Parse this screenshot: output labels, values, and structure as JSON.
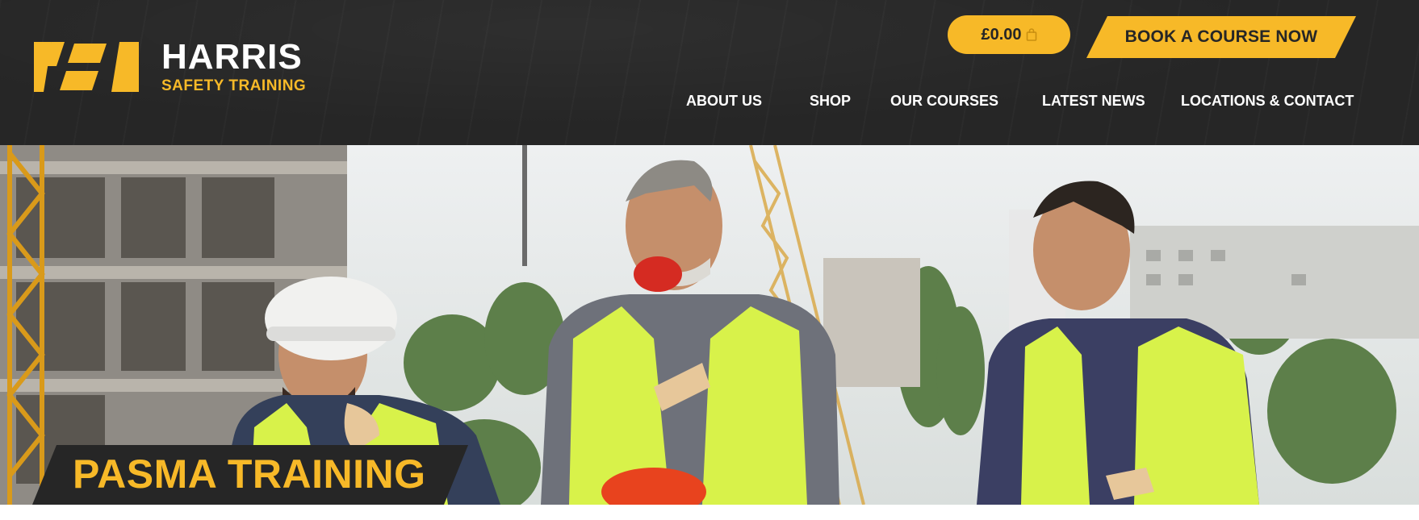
{
  "brand": {
    "name": "HARRIS",
    "tagline": "SAFETY TRAINING",
    "accent": "#f7b928",
    "dark": "#262626"
  },
  "header": {
    "cart": {
      "amount": "£0.00",
      "icon": "shopping-bag-icon"
    },
    "cta": {
      "label": "BOOK A COURSE NOW"
    }
  },
  "nav": {
    "items": [
      {
        "label": "ABOUT US"
      },
      {
        "label": "SHOP"
      },
      {
        "label": "OUR COURSES"
      },
      {
        "label": "LATEST NEWS"
      },
      {
        "label": "LOCATIONS & CONTACT"
      }
    ]
  },
  "hero": {
    "title": "PASMA TRAINING"
  }
}
